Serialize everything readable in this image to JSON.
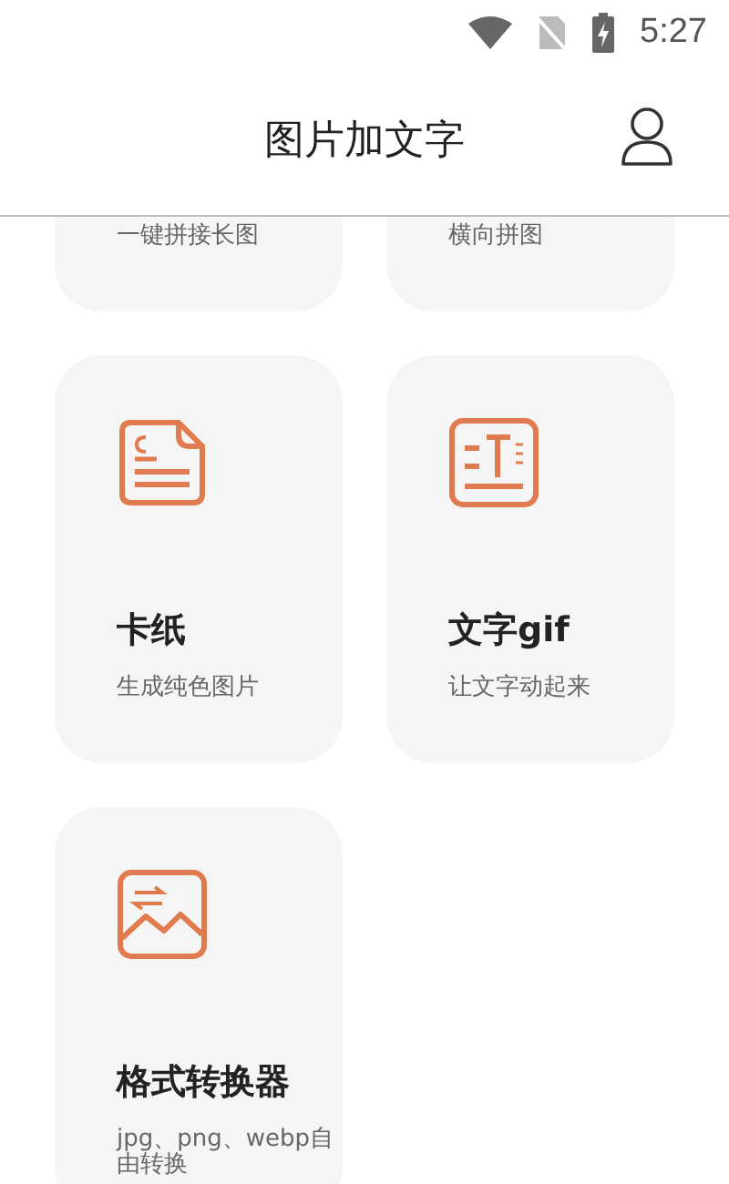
{
  "status_bar": {
    "time": "5:27"
  },
  "header": {
    "title": "图片加文字"
  },
  "tools": [
    {
      "subtitle": "一键拼接长图"
    },
    {
      "subtitle": "横向拼图"
    },
    {
      "kind": "card",
      "title": "卡纸",
      "subtitle": "生成纯色图片"
    },
    {
      "kind": "gif-text",
      "title": "文字gif",
      "subtitle": "让文字动起来"
    },
    {
      "kind": "image-convert",
      "title": "格式转换器",
      "subtitle": "jpg、png、webp自由转换"
    }
  ]
}
